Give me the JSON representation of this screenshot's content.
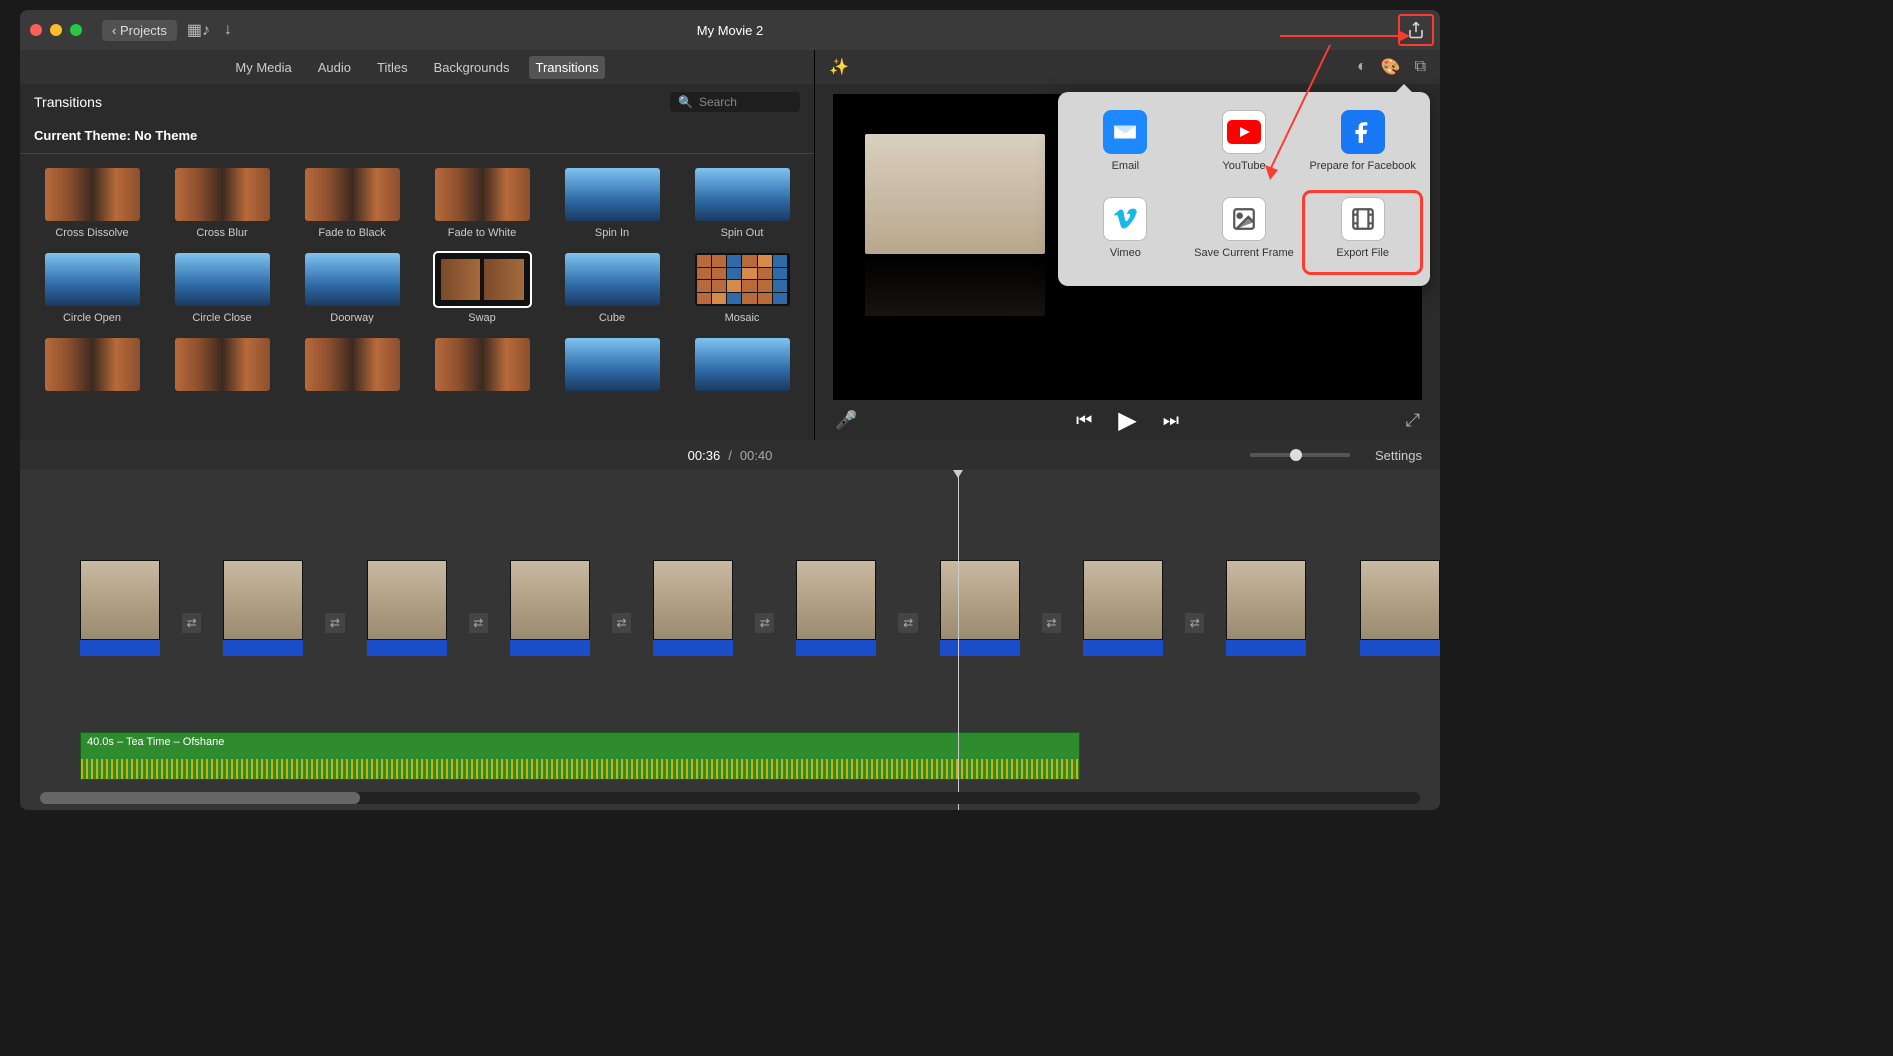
{
  "titlebar": {
    "projects_label": "Projects",
    "title": "My Movie 2"
  },
  "library": {
    "tabs": [
      "My Media",
      "Audio",
      "Titles",
      "Backgrounds",
      "Transitions"
    ],
    "active_tab_index": 4,
    "section_title": "Transitions",
    "search_placeholder": "Search",
    "theme_label": "Current Theme: No Theme",
    "transitions": [
      {
        "label": "Cross Dissolve",
        "style": "orange"
      },
      {
        "label": "Cross Blur",
        "style": "orange"
      },
      {
        "label": "Fade to Black",
        "style": "orange"
      },
      {
        "label": "Fade to White",
        "style": "orange"
      },
      {
        "label": "Spin In",
        "style": "blue"
      },
      {
        "label": "Spin Out",
        "style": "blue"
      },
      {
        "label": "Circle Open",
        "style": "blue"
      },
      {
        "label": "Circle Close",
        "style": "blue"
      },
      {
        "label": "Doorway",
        "style": "blue"
      },
      {
        "label": "Swap",
        "style": "swap",
        "selected": true
      },
      {
        "label": "Cube",
        "style": "blue"
      },
      {
        "label": "Mosaic",
        "style": "mosaic"
      },
      {
        "label": "",
        "style": "orange"
      },
      {
        "label": "",
        "style": "orange"
      },
      {
        "label": "",
        "style": "orange"
      },
      {
        "label": "",
        "style": "orange"
      },
      {
        "label": "",
        "style": "blue"
      },
      {
        "label": "",
        "style": "blue"
      }
    ]
  },
  "timeline": {
    "current_time": "00:36",
    "total_time": "00:40",
    "settings_label": "Settings",
    "audio_clip_label": "40.0s – Tea Time – Ofshane",
    "clip_count": 10
  },
  "share_popover": {
    "items": [
      {
        "label": "Email",
        "icon": "envelope",
        "bg": "#1e88ff"
      },
      {
        "label": "YouTube",
        "icon": "youtube",
        "bg": "#ffffff"
      },
      {
        "label": "Prepare for Facebook",
        "icon": "facebook",
        "bg": "#1877f2"
      },
      {
        "label": "Vimeo",
        "icon": "vimeo",
        "bg": "#ffffff"
      },
      {
        "label": "Save Current Frame",
        "icon": "image",
        "bg": "#ffffff"
      },
      {
        "label": "Export File",
        "icon": "film",
        "bg": "#ffffff",
        "highlighted": true
      }
    ]
  }
}
